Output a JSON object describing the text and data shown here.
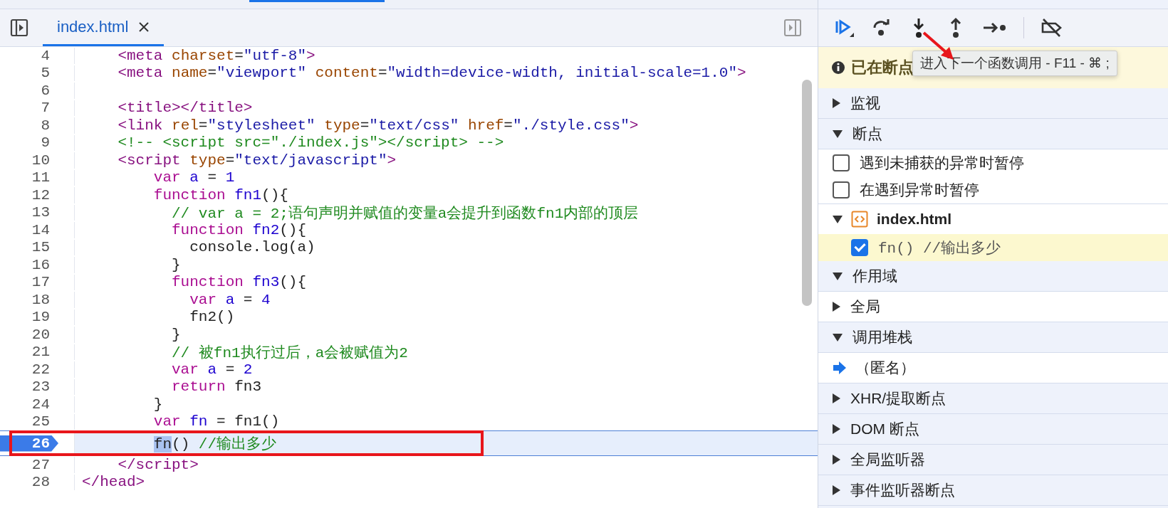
{
  "editor": {
    "tabs": [
      {
        "label": "index.html",
        "selected": true
      }
    ],
    "lines": [
      {
        "number": "4",
        "breakpoint": false,
        "paused": false,
        "tokens": [
          {
            "kind": "tag",
            "text": "    <meta"
          },
          {
            "kind": "attr",
            "text": " charset"
          },
          {
            "kind": "plain",
            "text": "="
          },
          {
            "kind": "str",
            "text": "\"utf-8\""
          },
          {
            "kind": "tag",
            "text": ">"
          }
        ]
      },
      {
        "number": "5",
        "breakpoint": false,
        "paused": false,
        "tokens": [
          {
            "kind": "tag",
            "text": "    <meta"
          },
          {
            "kind": "attr",
            "text": " name"
          },
          {
            "kind": "plain",
            "text": "="
          },
          {
            "kind": "str",
            "text": "\"viewport\""
          },
          {
            "kind": "attr",
            "text": " content"
          },
          {
            "kind": "plain",
            "text": "="
          },
          {
            "kind": "str",
            "text": "\"width=device-width, initial-scale=1.0\""
          },
          {
            "kind": "tag",
            "text": ">"
          }
        ]
      },
      {
        "number": "6",
        "breakpoint": false,
        "paused": false
      },
      {
        "number": "7",
        "breakpoint": false,
        "paused": false,
        "tokens": [
          {
            "kind": "tag",
            "text": "    <title></title>"
          }
        ]
      },
      {
        "number": "8",
        "breakpoint": false,
        "paused": false,
        "tokens": [
          {
            "kind": "tag",
            "text": "    <link"
          },
          {
            "kind": "attr",
            "text": " rel"
          },
          {
            "kind": "plain",
            "text": "="
          },
          {
            "kind": "str",
            "text": "\"stylesheet\""
          },
          {
            "kind": "attr",
            "text": " type"
          },
          {
            "kind": "plain",
            "text": "="
          },
          {
            "kind": "str",
            "text": "\"text/css\""
          },
          {
            "kind": "attr",
            "text": " href"
          },
          {
            "kind": "plain",
            "text": "="
          },
          {
            "kind": "str",
            "text": "\"./style.css\""
          },
          {
            "kind": "tag",
            "text": ">"
          }
        ]
      },
      {
        "number": "9",
        "breakpoint": false,
        "paused": false,
        "tokens": [
          {
            "kind": "cm",
            "text": "    <!-- <script src=\"./index.js\"></script> -->"
          }
        ]
      },
      {
        "number": "10",
        "breakpoint": false,
        "paused": false,
        "tokens": [
          {
            "kind": "tag",
            "text": "    <script"
          },
          {
            "kind": "attr",
            "text": " type"
          },
          {
            "kind": "plain",
            "text": "="
          },
          {
            "kind": "str",
            "text": "\"text/javascript\""
          },
          {
            "kind": "tag",
            "text": ">"
          }
        ]
      },
      {
        "number": "11",
        "breakpoint": false,
        "paused": false,
        "tokens": [
          {
            "kind": "kw",
            "text": "        var"
          },
          {
            "kind": "def",
            "text": " a"
          },
          {
            "kind": "plain",
            "text": " = "
          },
          {
            "kind": "num",
            "text": "1"
          }
        ]
      },
      {
        "number": "12",
        "breakpoint": false,
        "paused": false,
        "tokens": [
          {
            "kind": "kw",
            "text": "        function"
          },
          {
            "kind": "def",
            "text": " fn1"
          },
          {
            "kind": "plain",
            "text": "(){"
          }
        ]
      },
      {
        "number": "13",
        "breakpoint": false,
        "paused": false,
        "tokens": [
          {
            "kind": "cm",
            "text": "          // var a = 2;语句声明并赋值的变量a会提升到函数fn1内部的顶层"
          }
        ]
      },
      {
        "number": "14",
        "breakpoint": false,
        "paused": false,
        "tokens": [
          {
            "kind": "kw",
            "text": "          function"
          },
          {
            "kind": "def",
            "text": " fn2"
          },
          {
            "kind": "plain",
            "text": "(){"
          }
        ]
      },
      {
        "number": "15",
        "breakpoint": false,
        "paused": false,
        "tokens": [
          {
            "kind": "plain",
            "text": "            console.log(a)"
          }
        ]
      },
      {
        "number": "16",
        "breakpoint": false,
        "paused": false,
        "tokens": [
          {
            "kind": "plain",
            "text": "          }"
          }
        ]
      },
      {
        "number": "17",
        "breakpoint": false,
        "paused": false,
        "tokens": [
          {
            "kind": "kw",
            "text": "          function"
          },
          {
            "kind": "def",
            "text": " fn3"
          },
          {
            "kind": "plain",
            "text": "(){"
          }
        ]
      },
      {
        "number": "18",
        "breakpoint": false,
        "paused": false,
        "tokens": [
          {
            "kind": "kw",
            "text": "            var"
          },
          {
            "kind": "def",
            "text": " a"
          },
          {
            "kind": "plain",
            "text": " = "
          },
          {
            "kind": "num",
            "text": "4"
          }
        ]
      },
      {
        "number": "19",
        "breakpoint": false,
        "paused": false,
        "tokens": [
          {
            "kind": "plain",
            "text": "            fn2()"
          }
        ]
      },
      {
        "number": "20",
        "breakpoint": false,
        "paused": false,
        "tokens": [
          {
            "kind": "plain",
            "text": "          }"
          }
        ]
      },
      {
        "number": "21",
        "breakpoint": false,
        "paused": false,
        "tokens": [
          {
            "kind": "cm",
            "text": "          // 被fn1执行过后，a会被赋值为2"
          }
        ]
      },
      {
        "number": "22",
        "breakpoint": false,
        "paused": false,
        "tokens": [
          {
            "kind": "kw",
            "text": "          var"
          },
          {
            "kind": "def",
            "text": " a"
          },
          {
            "kind": "plain",
            "text": " = "
          },
          {
            "kind": "num",
            "text": "2"
          }
        ]
      },
      {
        "number": "23",
        "breakpoint": false,
        "paused": false,
        "tokens": [
          {
            "kind": "kw",
            "text": "          return"
          },
          {
            "kind": "plain",
            "text": " fn3"
          }
        ]
      },
      {
        "number": "24",
        "breakpoint": false,
        "paused": false,
        "tokens": [
          {
            "kind": "plain",
            "text": "        }"
          }
        ]
      },
      {
        "number": "25",
        "breakpoint": false,
        "paused": false,
        "tokens": [
          {
            "kind": "kw",
            "text": "        var"
          },
          {
            "kind": "def",
            "text": " fn"
          },
          {
            "kind": "plain",
            "text": " = fn1()"
          }
        ]
      },
      {
        "number": "26",
        "breakpoint": true,
        "paused": true,
        "tokens": [
          {
            "kind": "sel",
            "text": "        fn"
          },
          {
            "kind": "plain",
            "text": "() "
          },
          {
            "kind": "cm",
            "text": "//输出多少"
          }
        ]
      },
      {
        "number": "27",
        "breakpoint": false,
        "paused": false,
        "tokens": [
          {
            "kind": "tag",
            "text": "    </script>"
          }
        ]
      },
      {
        "number": "28",
        "breakpoint": false,
        "paused": false,
        "tokens": [
          {
            "kind": "tag",
            "text": "</head>"
          }
        ]
      }
    ]
  },
  "debugger": {
    "tooltip": "进入下一个函数调用 - F11 - ⌘ ;",
    "banner": "已在断点",
    "items": [
      {
        "kind": "section",
        "label": "监视",
        "expanded": false
      },
      {
        "kind": "section",
        "label": "断点",
        "expanded": true
      },
      {
        "kind": "checkbox",
        "label": "遇到未捕获的异常时暂停",
        "checked": false
      },
      {
        "kind": "checkbox",
        "label": "在遇到异常时暂停",
        "checked": false
      },
      {
        "kind": "file",
        "label": "index.html",
        "expanded": true
      },
      {
        "kind": "breakpoint",
        "label": "fn() //输出多少",
        "checked": true
      },
      {
        "kind": "section",
        "label": "作用域",
        "expanded": true
      },
      {
        "kind": "item",
        "label": "全局",
        "expanded": false
      },
      {
        "kind": "section",
        "label": "调用堆栈",
        "expanded": true
      },
      {
        "kind": "frame",
        "label": "（匿名）",
        "selected": true
      },
      {
        "kind": "section",
        "label": "XHR/提取断点",
        "expanded": false
      },
      {
        "kind": "section",
        "label": "DOM 断点",
        "expanded": false
      },
      {
        "kind": "section",
        "label": "全局监听器",
        "expanded": false
      },
      {
        "kind": "section",
        "label": "事件监听器断点",
        "expanded": false
      }
    ]
  }
}
